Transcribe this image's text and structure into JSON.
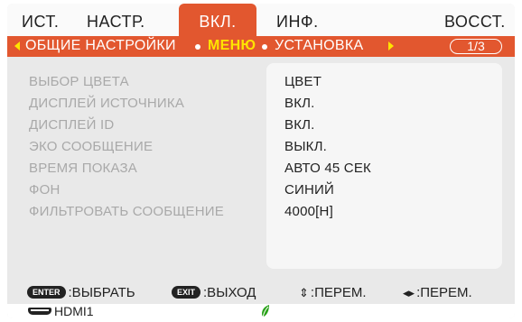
{
  "tabs": [
    "ИСТ.",
    "НАСТР.",
    "ВКЛ.",
    "ИНФ.",
    "ВОССТ."
  ],
  "active_tab": "ВКЛ.",
  "subnav": {
    "items": [
      "ОБЩИЕ НАСТРОЙКИ",
      "МЕНЮ",
      "УСТАНОВКА"
    ],
    "selected": "МЕНЮ",
    "page": "1/3"
  },
  "settings": [
    {
      "label": "ВЫБОР ЦВЕТА",
      "value": "ЦВЕТ"
    },
    {
      "label": "ДИСПЛЕЙ ИСТОЧНИКА",
      "value": "ВКЛ."
    },
    {
      "label": "ДИСПЛЕЙ ID",
      "value": "ВКЛ."
    },
    {
      "label": "ЭКО СООБЩЕНИЕ",
      "value": "ВЫКЛ."
    },
    {
      "label": "ВРЕМЯ ПОКАЗА",
      "value": "АВТО 45 СЕК"
    },
    {
      "label": "ФОН",
      "value": "СИНИЙ"
    },
    {
      "label": "ФИЛЬТРОВАТЬ СООБЩЕНИЕ",
      "value": "4000[H]"
    }
  ],
  "legend": {
    "enter_key": "ENTER",
    "enter_label": ":ВЫБРАТЬ",
    "exit_key": "EXIT",
    "exit_label": ":ВЫХОД",
    "updown_glyph": "⇕",
    "updown_label": ":ПЕРЕМ.",
    "leftright_glyph": "◂▸",
    "leftright_label": ":ПЕРЕМ."
  },
  "status": {
    "source": "HDMI1",
    "source_icon": "hdmi-icon",
    "eco_icon": "leaf-icon"
  },
  "colors": {
    "accent": "#e2572f",
    "highlight": "#ffe400",
    "eco": "#2aa21a"
  }
}
